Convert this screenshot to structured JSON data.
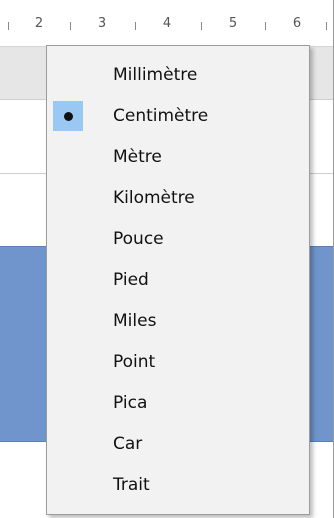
{
  "ruler": {
    "labels": [
      "2",
      "3",
      "4",
      "5",
      "6"
    ]
  },
  "menu": {
    "items": [
      {
        "label": "Millimètre",
        "selected": false
      },
      {
        "label": "Centimètre",
        "selected": true
      },
      {
        "label": "Mètre",
        "selected": false
      },
      {
        "label": "Kilomètre",
        "selected": false
      },
      {
        "label": "Pouce",
        "selected": false
      },
      {
        "label": "Pied",
        "selected": false
      },
      {
        "label": "Miles",
        "selected": false
      },
      {
        "label": "Point",
        "selected": false
      },
      {
        "label": "Pica",
        "selected": false
      },
      {
        "label": "Car",
        "selected": false
      },
      {
        "label": "Trait",
        "selected": false
      }
    ]
  },
  "colors": {
    "selection_highlight": "#99c9f3",
    "menu_background": "#f2f2f2",
    "blue_panel": "#6f95cc"
  }
}
